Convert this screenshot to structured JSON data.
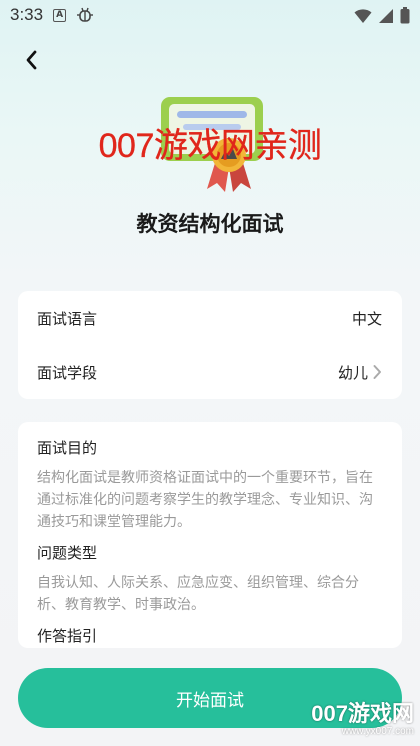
{
  "status_bar": {
    "time": "3:33",
    "icon_a_label": "A",
    "icons": [
      "keyboard-a-icon",
      "bug-icon",
      "wifi-icon",
      "signal-icon",
      "battery-icon"
    ]
  },
  "header": {
    "back_icon": "chevron-left-icon"
  },
  "hero": {
    "icon": "certificate-award-icon",
    "watermark_text": "007游戏网亲测",
    "title": "教资结构化面试"
  },
  "settings": {
    "language_label": "面试语言",
    "language_value": "中文",
    "stage_label": "面试学段",
    "stage_value": "幼儿"
  },
  "info": {
    "purpose_title": "面试目的",
    "purpose_body": "结构化面试是教师资格证面试中的一个重要环节，旨在通过标准化的问题考察学生的教学理念、专业知识、沟通技巧和课堂管理能力。",
    "types_title": "问题类型",
    "types_body": "自我认知、人际关系、应急应变、组织管理、综合分析、教育教学、时事政治。",
    "guide_title": "作答指引"
  },
  "actions": {
    "start_label": "开始面试"
  },
  "corner_watermark": {
    "logo_text": "007游戏网",
    "url_text": "www.yx007.com"
  },
  "colors": {
    "accent": "#26bf9b",
    "watermark_red": "#e0261b",
    "muted_text": "#9a9a9a"
  }
}
